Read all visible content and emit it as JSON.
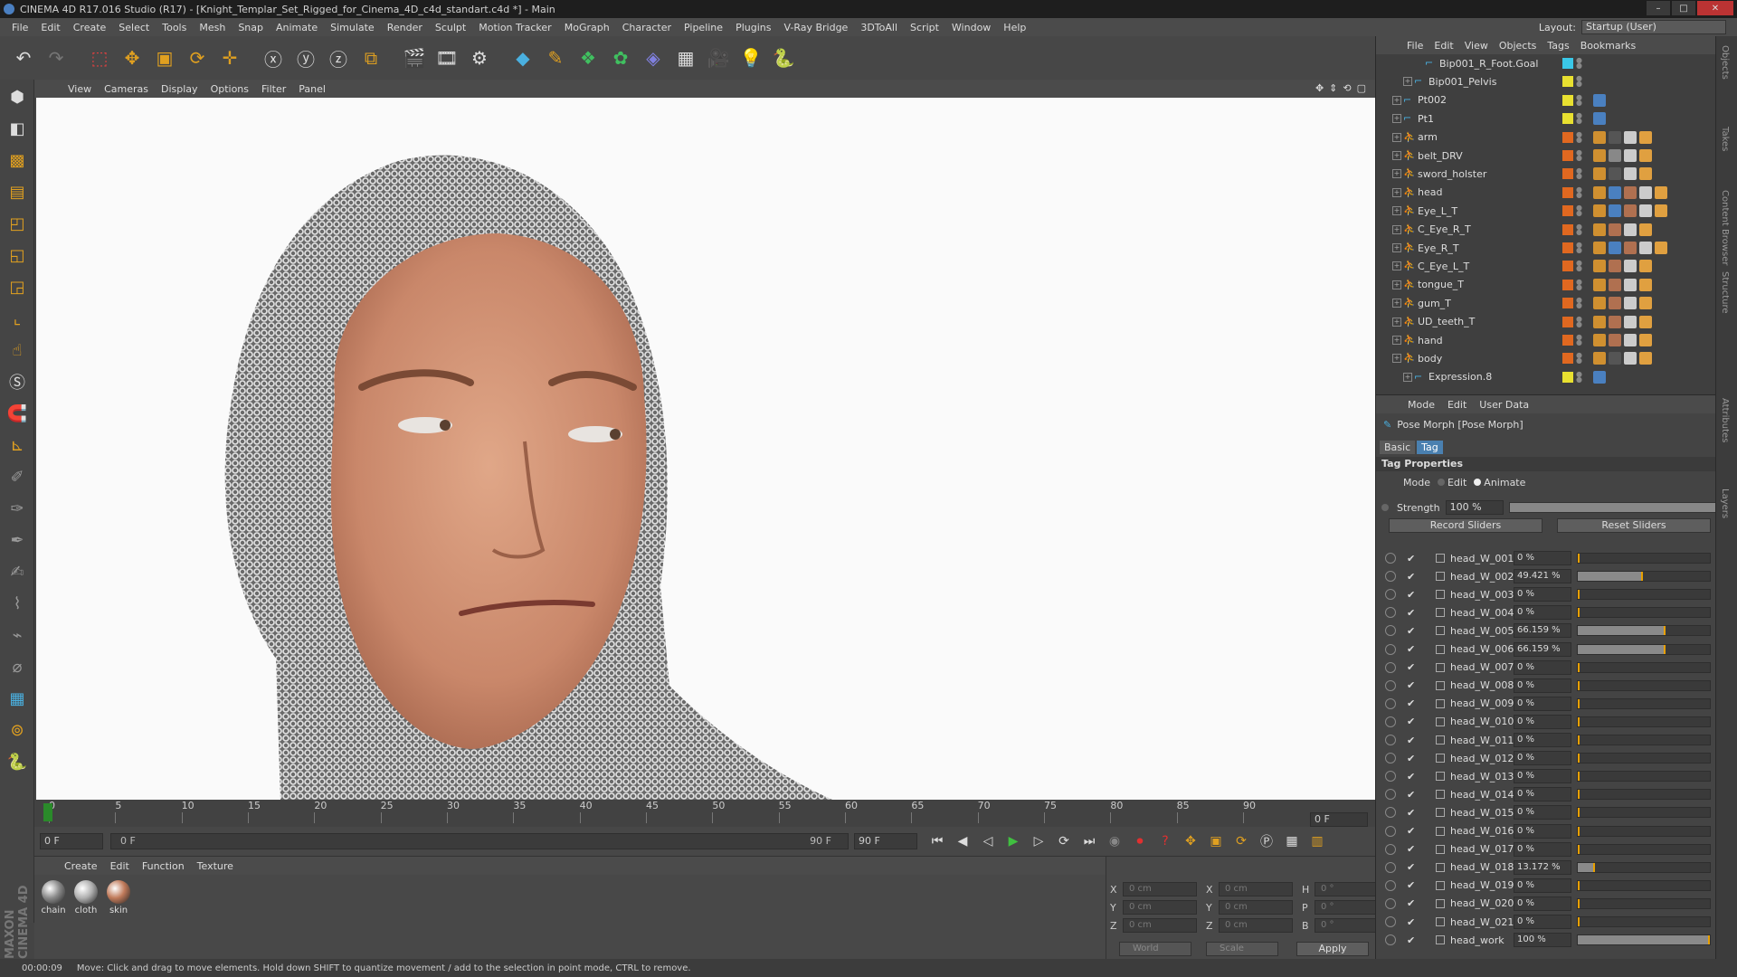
{
  "window": {
    "title": "CINEMA 4D R17.016 Studio (R17) - [Knight_Templar_Set_Rigged_for_Cinema_4D_c4d_standart.c4d *] - Main"
  },
  "menu": [
    "File",
    "Edit",
    "Create",
    "Select",
    "Tools",
    "Mesh",
    "Snap",
    "Animate",
    "Simulate",
    "Render",
    "Sculpt",
    "Motion Tracker",
    "MoGraph",
    "Character",
    "Pipeline",
    "Plugins",
    "V-Ray Bridge",
    "3DToAll",
    "Script",
    "Window",
    "Help"
  ],
  "layout": {
    "label": "Layout:",
    "value": "Startup (User)"
  },
  "viewport_menu": [
    "View",
    "Cameras",
    "Display",
    "Options",
    "Filter",
    "Panel"
  ],
  "timeline": {
    "ticks": [
      "0",
      "5",
      "10",
      "15",
      "20",
      "25",
      "30",
      "35",
      "40",
      "45",
      "50",
      "55",
      "60",
      "65",
      "70",
      "75",
      "80",
      "85",
      "90"
    ],
    "current_frame": "0 F",
    "start_field": "0 F",
    "range_start": "0 F",
    "range_end": "90 F",
    "end_field": "90 F"
  },
  "material_menu": [
    "Create",
    "Edit",
    "Function",
    "Texture"
  ],
  "materials": [
    {
      "name": "chain",
      "color": "#8a8a8a"
    },
    {
      "name": "cloth",
      "color": "#b0b0b0"
    },
    {
      "name": "skin",
      "color": "#c07a5a"
    }
  ],
  "coords": {
    "rows": [
      {
        "a1": "X",
        "v1": "0 cm",
        "a2": "X",
        "v2": "0 cm",
        "a3": "H",
        "v3": "0 °"
      },
      {
        "a1": "Y",
        "v1": "0 cm",
        "a2": "Y",
        "v2": "0 cm",
        "a3": "P",
        "v3": "0 °"
      },
      {
        "a1": "Z",
        "v1": "0 cm",
        "a2": "Z",
        "v2": "0 cm",
        "a3": "B",
        "v3": "0 °"
      }
    ],
    "space": "World",
    "mode": "Scale",
    "apply": "Apply"
  },
  "status": {
    "time": "00:00:09",
    "text": "Move: Click and drag to move elements. Hold down SHIFT to quantize movement / add to the selection in point mode, CTRL to remove."
  },
  "logo_text": "MAXON CINEMA 4D",
  "objects_menu": [
    "File",
    "Edit",
    "View",
    "Objects",
    "Tags",
    "Bookmarks"
  ],
  "objects": [
    {
      "name": "Bip001_R_Foot.Goal",
      "indent": 2,
      "layer": "#3ac8e8",
      "tags": []
    },
    {
      "name": "Bip001_Pelvis",
      "indent": 1,
      "layer": "#e8e030",
      "tags": []
    },
    {
      "name": "Pt002",
      "indent": 0,
      "layer": "#e8e030",
      "tags": [
        "#4a80c0"
      ]
    },
    {
      "name": "Pt1",
      "indent": 0,
      "layer": "#e8e030",
      "tags": [
        "#4a80c0"
      ]
    },
    {
      "name": "arm",
      "indent": 0,
      "layer": "#e06820",
      "tags": [
        "#d09030",
        "#555",
        "#ccc",
        "#e0a040"
      ]
    },
    {
      "name": "belt_DRV",
      "indent": 0,
      "layer": "#e06820",
      "tags": [
        "#d09030",
        "#888",
        "#ccc",
        "#e0a040"
      ]
    },
    {
      "name": "sword_holster",
      "indent": 0,
      "layer": "#e06820",
      "tags": [
        "#d09030",
        "#555",
        "#ccc",
        "#e0a040"
      ]
    },
    {
      "name": "head",
      "indent": 0,
      "layer": "#e06820",
      "tags": [
        "#d09030",
        "#4a80c0",
        "#b07050",
        "#ccc",
        "#e0a040"
      ]
    },
    {
      "name": "Eye_L_T",
      "indent": 0,
      "layer": "#e06820",
      "tags": [
        "#d09030",
        "#4a80c0",
        "#b07050",
        "#ccc",
        "#e0a040"
      ]
    },
    {
      "name": "C_Eye_R_T",
      "indent": 0,
      "layer": "#e06820",
      "tags": [
        "#d09030",
        "#b07050",
        "#ccc",
        "#e0a040"
      ]
    },
    {
      "name": "Eye_R_T",
      "indent": 0,
      "layer": "#e06820",
      "tags": [
        "#d09030",
        "#4a80c0",
        "#b07050",
        "#ccc",
        "#e0a040"
      ]
    },
    {
      "name": "C_Eye_L_T",
      "indent": 0,
      "layer": "#e06820",
      "tags": [
        "#d09030",
        "#b07050",
        "#ccc",
        "#e0a040"
      ]
    },
    {
      "name": "tongue_T",
      "indent": 0,
      "layer": "#e06820",
      "tags": [
        "#d09030",
        "#b07050",
        "#ccc",
        "#e0a040"
      ]
    },
    {
      "name": "gum_T",
      "indent": 0,
      "layer": "#e06820",
      "tags": [
        "#d09030",
        "#b07050",
        "#ccc",
        "#e0a040"
      ]
    },
    {
      "name": "UD_teeth_T",
      "indent": 0,
      "layer": "#e06820",
      "tags": [
        "#d09030",
        "#b07050",
        "#ccc",
        "#e0a040"
      ]
    },
    {
      "name": "hand",
      "indent": 0,
      "layer": "#e06820",
      "tags": [
        "#d09030",
        "#b07050",
        "#ccc",
        "#e0a040"
      ]
    },
    {
      "name": "body",
      "indent": 0,
      "layer": "#e06820",
      "tags": [
        "#d09030",
        "#555",
        "#ccc",
        "#e0a040"
      ]
    },
    {
      "name": "Expression.8",
      "indent": 1,
      "layer": "#e8e030",
      "tags": [
        "#4a80c0"
      ]
    }
  ],
  "attr_menu": [
    "Mode",
    "Edit",
    "User Data"
  ],
  "attr": {
    "title": "Pose Morph [Pose Morph]",
    "tabs": [
      "Basic",
      "Tag"
    ],
    "section": "Tag Properties",
    "mode_label": "Mode",
    "mode_edit": "Edit",
    "mode_animate": "Animate",
    "strength_label": "Strength",
    "strength_value": "100 %",
    "record": "Record Sliders",
    "reset": "Reset Sliders"
  },
  "sliders": [
    {
      "name": "head_W_001",
      "value": "0 %",
      "pct": 0
    },
    {
      "name": "head_W_002",
      "value": "49.421 %",
      "pct": 49.421
    },
    {
      "name": "head_W_003",
      "value": "0 %",
      "pct": 0
    },
    {
      "name": "head_W_004",
      "value": "0 %",
      "pct": 0
    },
    {
      "name": "head_W_005",
      "value": "66.159 %",
      "pct": 66.159
    },
    {
      "name": "head_W_006",
      "value": "66.159 %",
      "pct": 66.159
    },
    {
      "name": "head_W_007",
      "value": "0 %",
      "pct": 0
    },
    {
      "name": "head_W_008",
      "value": "0 %",
      "pct": 0
    },
    {
      "name": "head_W_009",
      "value": "0 %",
      "pct": 0
    },
    {
      "name": "head_W_010",
      "value": "0 %",
      "pct": 0
    },
    {
      "name": "head_W_011",
      "value": "0 %",
      "pct": 0
    },
    {
      "name": "head_W_012",
      "value": "0 %",
      "pct": 0
    },
    {
      "name": "head_W_013",
      "value": "0 %",
      "pct": 0
    },
    {
      "name": "head_W_014",
      "value": "0 %",
      "pct": 0
    },
    {
      "name": "head_W_015",
      "value": "0 %",
      "pct": 0
    },
    {
      "name": "head_W_016",
      "value": "0 %",
      "pct": 0
    },
    {
      "name": "head_W_017",
      "value": "0 %",
      "pct": 0
    },
    {
      "name": "head_W_018",
      "value": "13.172 %",
      "pct": 13.172
    },
    {
      "name": "head_W_019",
      "value": "0 %",
      "pct": 0
    },
    {
      "name": "head_W_020",
      "value": "0 %",
      "pct": 0
    },
    {
      "name": "head_W_021",
      "value": "0 %",
      "pct": 0
    },
    {
      "name": "head_work",
      "value": "100 %",
      "pct": 100
    }
  ],
  "side_tabs": [
    "Objects",
    "Takes",
    "Content Browser",
    "Structure",
    "Attributes",
    "Layers"
  ]
}
